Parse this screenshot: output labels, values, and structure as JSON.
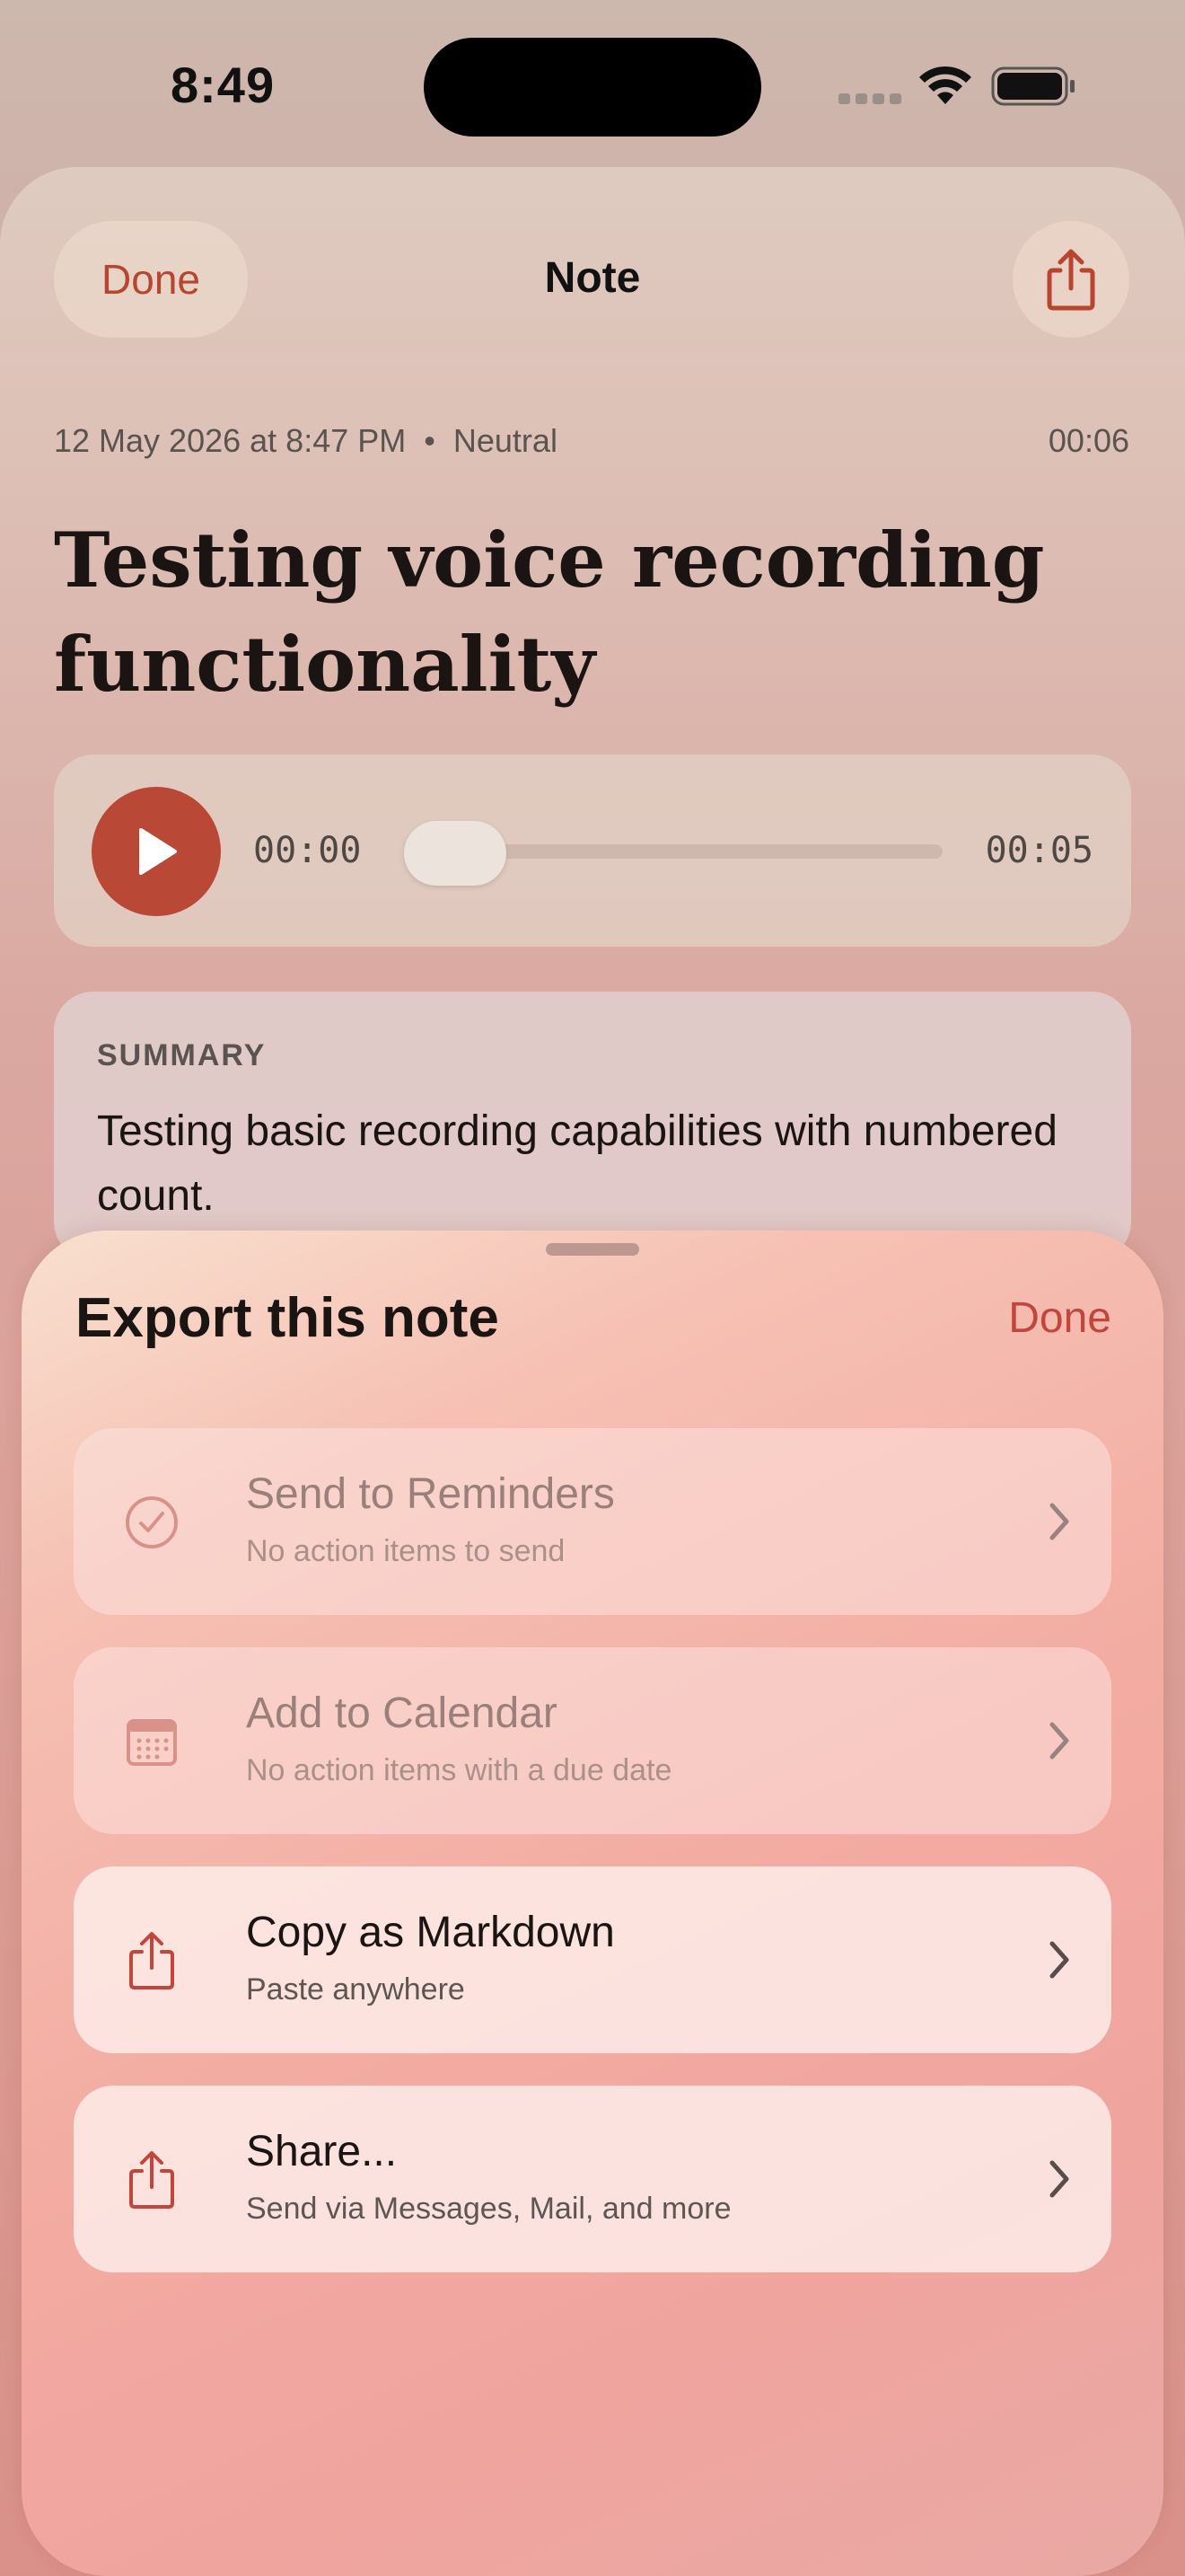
{
  "status_bar": {
    "time": "8:49"
  },
  "note_screen": {
    "nav": {
      "done_label": "Done",
      "title": "Note"
    },
    "meta": {
      "date": "12 May 2026 at 8:47 PM",
      "separator": "•",
      "mood": "Neutral",
      "duration": "00:06"
    },
    "title": "Testing voice recording functionality",
    "player": {
      "current_time": "00:00",
      "total_time": "00:05",
      "progress": 0.0
    },
    "summary": {
      "label": "SUMMARY",
      "text": "Testing basic recording capabilities with numbered count."
    }
  },
  "export_sheet": {
    "title": "Export this note",
    "done_label": "Done",
    "rows": [
      {
        "title": "Send to Reminders",
        "subtitle": "No action items to send",
        "icon": "checkmark-circle-icon",
        "enabled": false
      },
      {
        "title": "Add to Calendar",
        "subtitle": "No action items with a due date",
        "icon": "calendar-icon",
        "enabled": false
      },
      {
        "title": "Copy as Markdown",
        "subtitle": "Paste anywhere",
        "icon": "share-icon",
        "enabled": true
      },
      {
        "title": "Share...",
        "subtitle": "Send via Messages, Mail, and more",
        "icon": "share-icon",
        "enabled": true
      }
    ]
  },
  "colors": {
    "accent": "#c2463b",
    "play_button": "#b94837"
  }
}
